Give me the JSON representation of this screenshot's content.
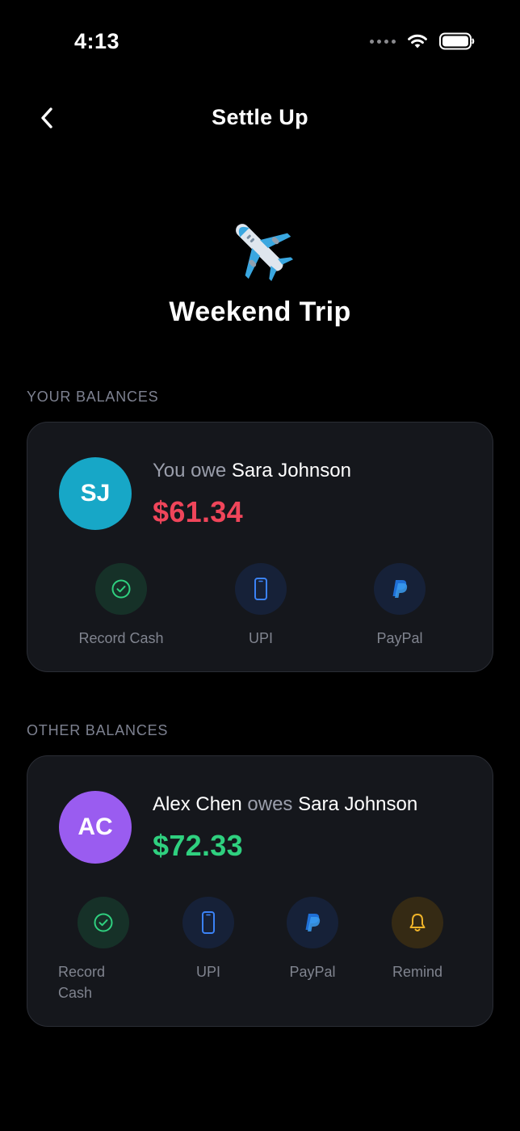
{
  "status_bar": {
    "time": "4:13"
  },
  "nav": {
    "title": "Settle Up"
  },
  "group": {
    "emoji": "✈️",
    "name": "Weekend Trip"
  },
  "your_balances": {
    "section_label": "YOUR BALANCES",
    "avatar_initials": "SJ",
    "avatar_color": "#17a7c7",
    "prefix": "You owe",
    "person": "Sara Johnson",
    "amount": "$61.34",
    "amount_color": "#f0455a",
    "actions": [
      {
        "label": "Record Cash",
        "icon": "check-circle-icon"
      },
      {
        "label": "UPI",
        "icon": "phone-icon"
      },
      {
        "label": "PayPal",
        "icon": "paypal-icon"
      }
    ]
  },
  "other_balances": {
    "section_label": "OTHER BALANCES",
    "avatar_initials": "AC",
    "avatar_color": "#9a5cf0",
    "debtor": "Alex Chen",
    "verb": "owes",
    "creditor": "Sara Johnson",
    "amount": "$72.33",
    "amount_color": "#2fd07f",
    "actions": [
      {
        "label_line1": "Record",
        "label_line2": "Cash",
        "icon": "check-circle-icon"
      },
      {
        "label": "UPI",
        "icon": "phone-icon"
      },
      {
        "label": "PayPal",
        "icon": "paypal-icon"
      },
      {
        "label": "Remind",
        "icon": "bell-icon"
      }
    ]
  },
  "colors": {
    "background": "#000000",
    "card": "#15171c",
    "green_icon": "#2fd07f",
    "blue_icon": "#3b82f6",
    "yellow_icon": "#f0b429"
  }
}
